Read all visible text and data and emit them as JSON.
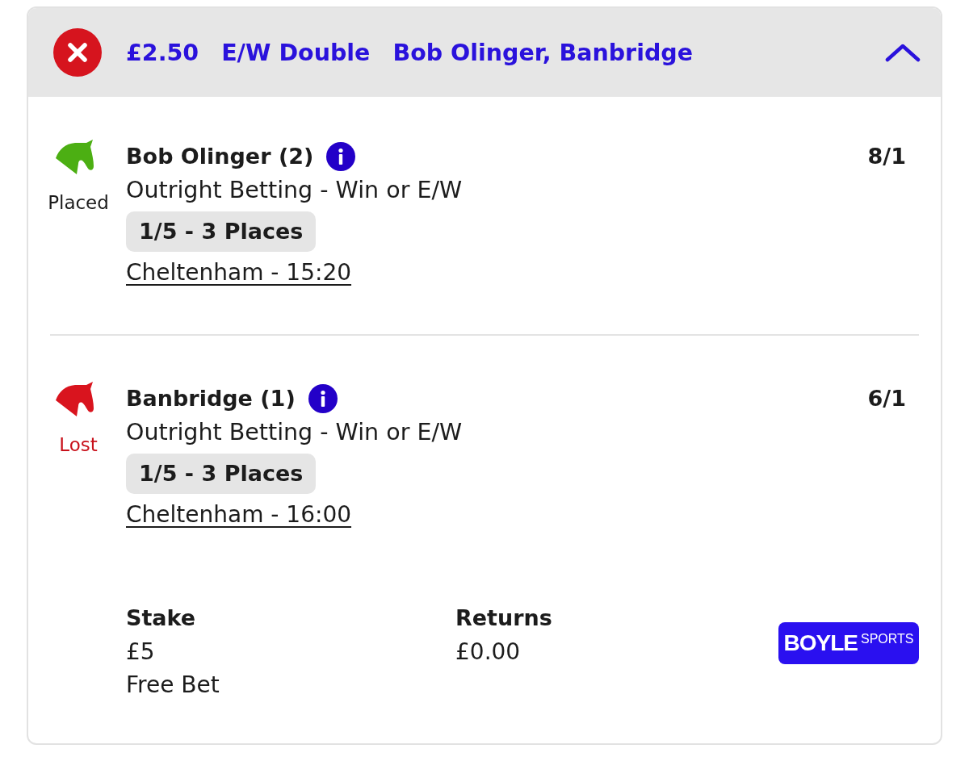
{
  "header": {
    "kind": "lost",
    "stake": "£2.50",
    "bet_type": "E/W Double",
    "selections": "Bob Olinger, Banbridge",
    "expanded": true
  },
  "selections": [
    {
      "kind": "placed",
      "status": "Placed",
      "name": "Bob Olinger (2)",
      "market": "Outright Betting - Win or E/W",
      "terms": "1/5 - 3 Places",
      "event": "Cheltenham - 15:20",
      "odds": "8/1"
    },
    {
      "kind": "lost",
      "status": "Lost",
      "name": "Banbridge (1)",
      "market": "Outright Betting - Win or E/W",
      "terms": "1/5 - 3 Places",
      "event": "Cheltenham - 16:00",
      "odds": "6/1"
    }
  ],
  "summary": {
    "stake_label": "Stake",
    "stake": "£5",
    "stake_note": "Free Bet",
    "returns_label": "Returns",
    "returns": "£0.00"
  },
  "brand": {
    "wordmark": "BOYLE",
    "tagline": "SPORTS"
  }
}
